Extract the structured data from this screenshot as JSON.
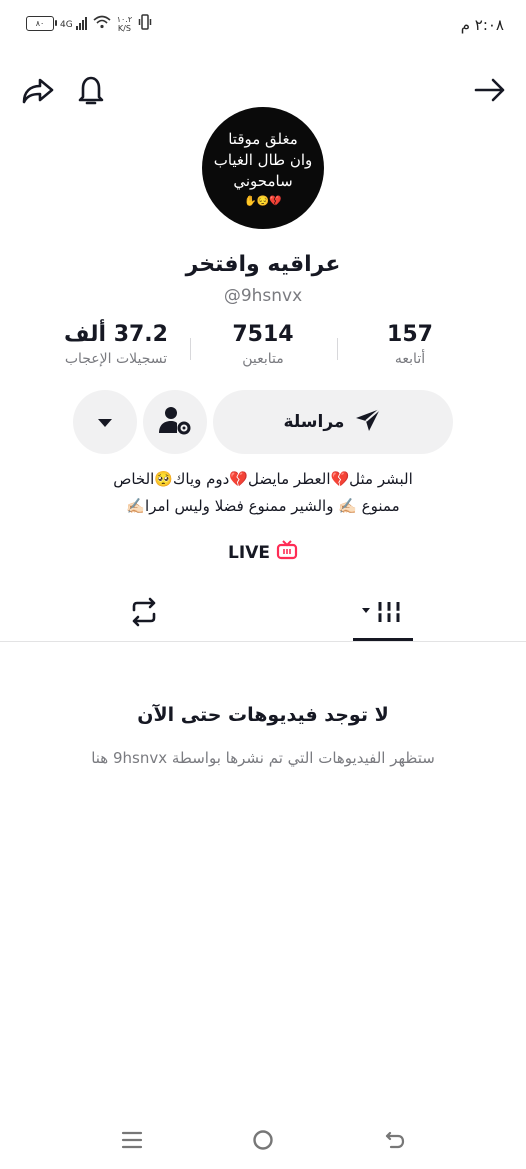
{
  "status_bar": {
    "time": "٢:٠٨ م",
    "battery": "٨٠",
    "network": "4G",
    "speed_value": "١٠.٢",
    "speed_unit": "K/S"
  },
  "profile": {
    "avatar_lines": [
      "مغلق موقتا",
      "وان طال الغياب",
      "سامحوني"
    ],
    "avatar_emoji": "💔😔✋",
    "display_name": "عراقيه وافتخر",
    "username": "@9hsnvx"
  },
  "stats": {
    "following": {
      "value": "157",
      "label": "أتابعه"
    },
    "followers": {
      "value": "7514",
      "label": "متابعين"
    },
    "likes": {
      "value": "37.2 ألف",
      "label": "تسجيلات الإعجاب"
    }
  },
  "actions": {
    "message_label": "مراسلة"
  },
  "bio": {
    "line1": "البشر مثل💔العطر مايضل💔دوم وياك🥺الخاص",
    "line2": "ممنوع ✍🏻 والشير ممنوع فضلا وليس امرا✍🏻"
  },
  "live_label": "LIVE",
  "empty_state": {
    "title": "لا توجد فيديوهات حتى الآن",
    "subtitle": "ستظهر الفيديوهات التي تم نشرها بواسطة 9hsnvx هنا"
  },
  "colors": {
    "live_accent": "#fe2c55",
    "text": "#161823",
    "muted": "#7a7b80",
    "button_bg": "#f1f1f2"
  }
}
